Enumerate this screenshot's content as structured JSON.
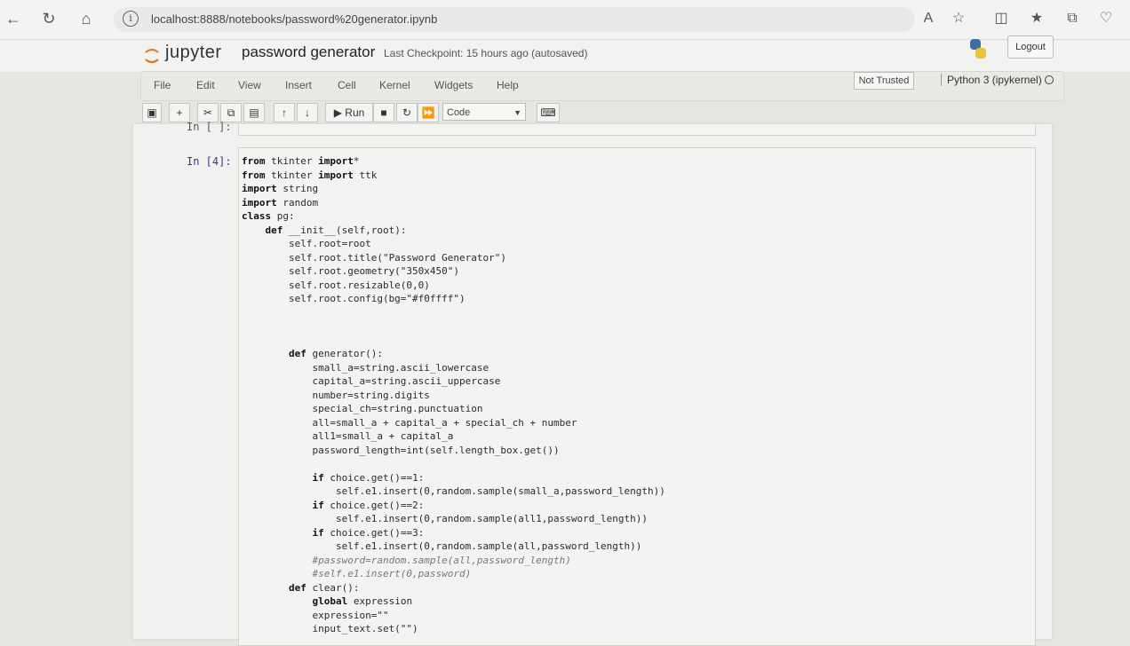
{
  "browser": {
    "url": "localhost:8888/notebooks/password%20generator.ipynb"
  },
  "jupyter": {
    "logo_text": "jupyter",
    "notebook_name": "password generator",
    "checkpoint": "Last Checkpoint: 15 hours ago  (autosaved)",
    "logout_label": "Logout",
    "menu": [
      "File",
      "Edit",
      "View",
      "Insert",
      "Cell",
      "Kernel",
      "Widgets",
      "Help"
    ],
    "not_trusted": "Not Trusted",
    "kernel": "Python 3 (ipykernel)",
    "toolbar": {
      "run_label": "Run",
      "cell_type": "Code"
    }
  },
  "cells": {
    "prev_prompt": "In [ ]:",
    "prompt": "In [4]:",
    "code_lines": [
      "from tkinter import*",
      "from tkinter import ttk",
      "import string",
      "import random",
      "class pg:",
      "    def __init__(self,root):",
      "        self.root=root",
      "        self.root.title(\"Password Generator\")",
      "        self.root.geometry(\"350x450\")",
      "        self.root.resizable(0,0)",
      "        self.root.config(bg=\"#f0ffff\")",
      "",
      "",
      "",
      "        def generator():",
      "            small_a=string.ascii_lowercase",
      "            capital_a=string.ascii_uppercase",
      "            number=string.digits",
      "            special_ch=string.punctuation",
      "            all=small_a + capital_a + special_ch + number",
      "            all1=small_a + capital_a",
      "            password_length=int(self.length_box.get())",
      "",
      "            if choice.get()==1:",
      "                self.e1.insert(0,random.sample(small_a,password_length))",
      "            if choice.get()==2:",
      "                self.e1.insert(0,random.sample(all1,password_length))",
      "            if choice.get()==3:",
      "                self.e1.insert(0,random.sample(all,password_length))",
      "            #password=random.sample(all,password_length)",
      "            #self.e1.insert(0,password)",
      "        def clear():",
      "            global expression",
      "            expression=\"\"",
      "            input_text.set(\"\")"
    ]
  }
}
